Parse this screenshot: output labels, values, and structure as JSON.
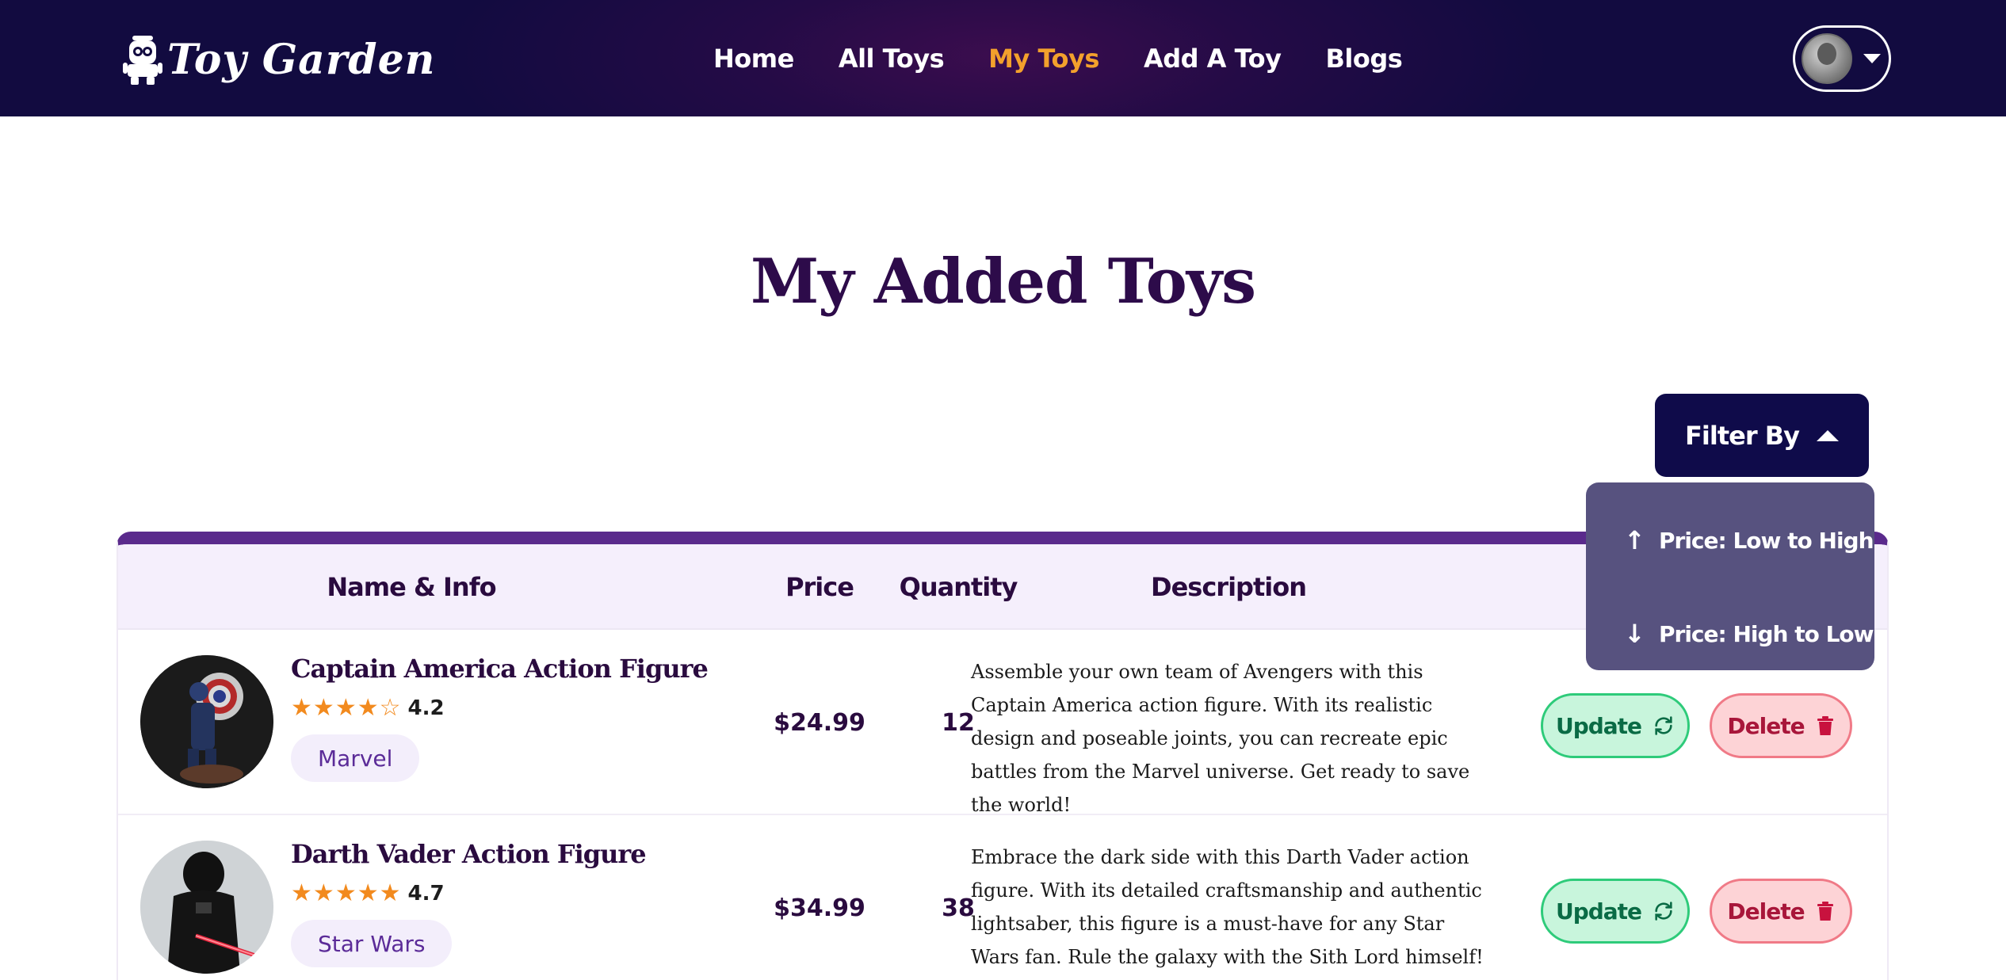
{
  "brand": {
    "name": "Toy Garden",
    "icon": "robot-icon"
  },
  "nav": {
    "links": [
      {
        "label": "Home",
        "active": false
      },
      {
        "label": "All Toys",
        "active": false
      },
      {
        "label": "My Toys",
        "active": true
      },
      {
        "label": "Add A Toy",
        "active": false
      },
      {
        "label": "Blogs",
        "active": false
      }
    ],
    "active_color": "#f3a12c"
  },
  "page": {
    "title": "My Added Toys"
  },
  "filter": {
    "label": "Filter By",
    "open": true,
    "options": [
      {
        "label": "Price: Low to High",
        "icon": "arrow-up-icon"
      },
      {
        "label": "Price: High to Low",
        "icon": "arrow-down-icon"
      }
    ]
  },
  "table": {
    "headers": [
      "Name & Info",
      "Price",
      "Quantity",
      "Description"
    ],
    "rows": [
      {
        "name": "Captain America Action Figure",
        "rating": 4.2,
        "rating_label": "4.2",
        "category": "Marvel",
        "price": "$24.99",
        "quantity": "12",
        "description": "Assemble your own team of Avengers with this Captain America action figure. With its realistic design and poseable joints, you can recreate epic battles from the Marvel universe. Get ready to save the world!"
      },
      {
        "name": "Darth Vader Action Figure",
        "rating": 4.7,
        "rating_label": "4.7",
        "category": "Star Wars",
        "price": "$34.99",
        "quantity": "38",
        "description": "Embrace the dark side with this Darth Vader action figure. With its detailed craftsmanship and authentic lightsaber, this figure is a must-have for any Star Wars fan. Rule the galaxy with the Sith Lord himself!"
      }
    ],
    "update_label": "Update",
    "delete_label": "Delete"
  },
  "colors": {
    "nav_bg": "#120b40",
    "title": "#2d0b4a",
    "filter_bg": "#0f0b4a",
    "dropdown_bg": "#57527f",
    "table_accent": "#5a2a8c",
    "update_bg": "#c8f5dc",
    "delete_bg": "#fdd3d6",
    "star": "#f28a1e"
  }
}
